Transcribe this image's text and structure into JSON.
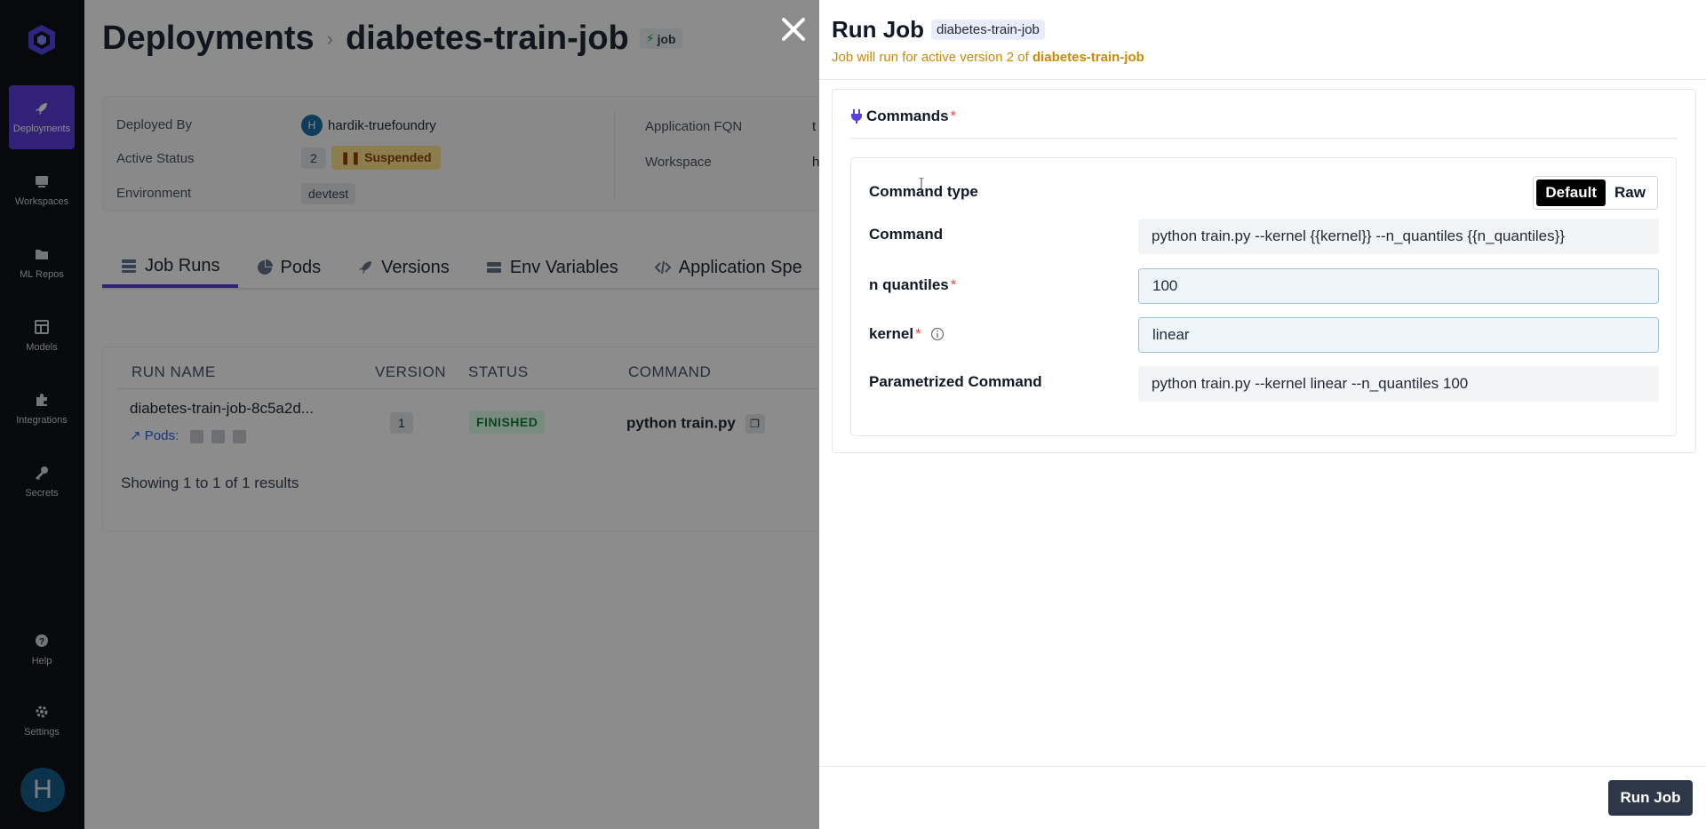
{
  "sidebar": {
    "items": [
      {
        "label": "Deployments",
        "icon": "rocket-icon"
      },
      {
        "label": "Workspaces",
        "icon": "workspaces-icon"
      },
      {
        "label": "ML Repos",
        "icon": "folder-icon"
      },
      {
        "label": "Models",
        "icon": "table-icon"
      },
      {
        "label": "Integrations",
        "icon": "puzzle-icon"
      },
      {
        "label": "Secrets",
        "icon": "key-icon"
      },
      {
        "label": "Help",
        "icon": "help-icon"
      },
      {
        "label": "Settings",
        "icon": "gear-icon"
      }
    ],
    "avatar_initial": "H",
    "accent": "#5b3fd9"
  },
  "header": {
    "breadcrumb_root": "Deployments",
    "breadcrumb_current": "diabetes-train-job",
    "type_badge": "job"
  },
  "info": {
    "deployed_by_label": "Deployed By",
    "deployed_by_initial": "H",
    "deployed_by_value": "hardik-truefoundry",
    "active_status_label": "Active Status",
    "active_version": "2",
    "status_value": "Suspended",
    "environment_label": "Environment",
    "environment_value": "devtest",
    "fqn_label": "Application FQN",
    "fqn_value_partial": "t",
    "workspace_label": "Workspace",
    "workspace_value_partial": "h"
  },
  "tabs": [
    {
      "label": "Job Runs",
      "icon": "list-icon"
    },
    {
      "label": "Pods",
      "icon": "pie-icon"
    },
    {
      "label": "Versions",
      "icon": "rocket-icon"
    },
    {
      "label": "Env Variables",
      "icon": "stack-icon"
    },
    {
      "label": "Application Spe",
      "icon": "code-icon"
    }
  ],
  "table": {
    "columns": [
      "RUN NAME",
      "VERSION",
      "STATUS",
      "COMMAND"
    ],
    "rows": [
      {
        "run_name": "diabetes-train-job-8c5a2d...",
        "pods_label": "Pods:",
        "version": "1",
        "status": "FINISHED",
        "command": "python train.py"
      }
    ],
    "footer": "Showing 1 to 1 of 1 results"
  },
  "drawer": {
    "title": "Run Job",
    "title_chip": "diabetes-train-job",
    "subtitle_prefix": "Job will run for active version 2 of ",
    "subtitle_app": "diabetes-train-job",
    "commands_title": "Commands",
    "required_mark": "*",
    "command_type_label": "Command type",
    "command_type_options": [
      "Default",
      "Raw"
    ],
    "command_type_selected": "Default",
    "command_label": "Command",
    "command_value": "python train.py --kernel {{kernel}} --n_quantiles {{n_quantiles}}",
    "n_quantiles_label": "n quantiles",
    "n_quantiles_value": "100",
    "kernel_label": "kernel",
    "kernel_value": "linear",
    "parametrized_label": "Parametrized Command",
    "parametrized_value": "python train.py --kernel linear --n_quantiles 100",
    "run_button": "Run Job"
  }
}
